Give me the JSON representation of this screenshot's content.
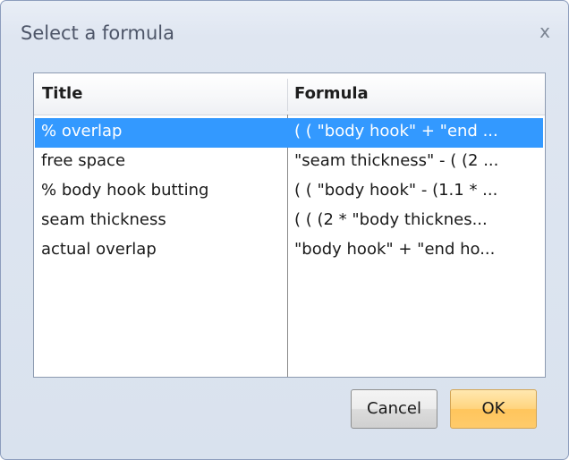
{
  "dialog": {
    "title": "Select a formula",
    "close_label": "x"
  },
  "list": {
    "columns": {
      "title": "Title",
      "formula": "Formula"
    },
    "rows": [
      {
        "title": "% overlap",
        "formula": "( ( \"body hook\" +  \"end ...",
        "selected": true
      },
      {
        "title": "free space",
        "formula": "\"seam thickness\"  -  ( (2 ...",
        "selected": false
      },
      {
        "title": "% body hook butting",
        "formula": "( ( \"body hook\"  -  (1.1 * ...",
        "selected": false
      },
      {
        "title": "seam thickness",
        "formula": "(  (  (2  * \"body thicknes...",
        "selected": false
      },
      {
        "title": "actual overlap",
        "formula": "\"body hook\"  +  \"end ho...",
        "selected": false
      }
    ]
  },
  "buttons": {
    "cancel_label": "Cancel",
    "ok_label": "OK"
  },
  "colors": {
    "selection": "#3399ff",
    "ok_button": "#ffd47e",
    "dialog_background": "#dfe6f1"
  }
}
